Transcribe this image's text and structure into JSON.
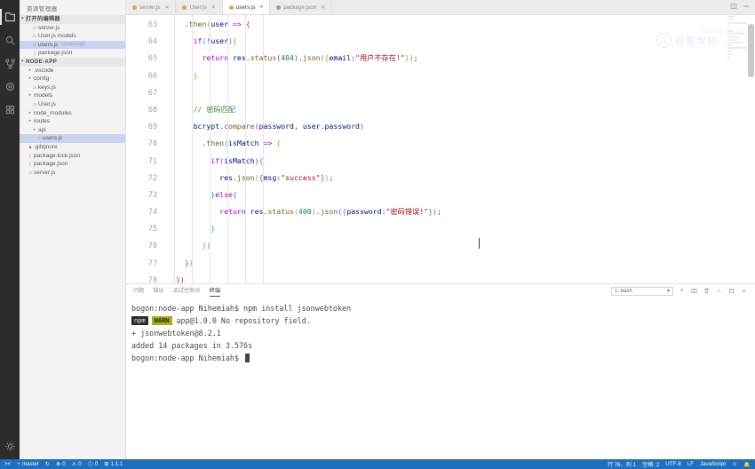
{
  "activity_bar": {
    "items": [
      {
        "name": "explorer",
        "icon": "files-icon",
        "active": true
      },
      {
        "name": "search",
        "icon": "search-icon",
        "active": false
      },
      {
        "name": "source-control",
        "icon": "source-control-icon",
        "active": false
      },
      {
        "name": "debug",
        "icon": "debug-icon",
        "active": false
      },
      {
        "name": "extensions",
        "icon": "extensions-icon",
        "active": false
      }
    ],
    "bottom": [
      {
        "name": "manage",
        "icon": "gear-icon"
      }
    ]
  },
  "sidebar": {
    "title": "资源管理器",
    "sections": [
      {
        "label": "打开的编辑器",
        "expanded": true,
        "items": [
          {
            "label": "server.js",
            "icon": "js-file-icon",
            "indent": 2,
            "selected": false,
            "meta": ""
          },
          {
            "label": "User.js  models",
            "icon": "js-file-icon",
            "indent": 2,
            "selected": false,
            "meta": ""
          },
          {
            "label": "users.js",
            "icon": "js-file-icon",
            "indent": 2,
            "selected": true,
            "meta": "routes/api"
          },
          {
            "label": "package.json",
            "icon": "json-file-icon",
            "indent": 2,
            "selected": false,
            "meta": ""
          }
        ]
      },
      {
        "label": "NODE-APP",
        "expanded": true,
        "items": [
          {
            "label": ".vscode",
            "icon": "folder-icon",
            "indent": 1,
            "selected": false,
            "meta": ""
          },
          {
            "label": "config",
            "icon": "folder-icon",
            "indent": 1,
            "selected": false,
            "meta": ""
          },
          {
            "label": "keys.js",
            "icon": "js-file-icon",
            "indent": 2,
            "selected": false,
            "meta": ""
          },
          {
            "label": "models",
            "icon": "folder-icon",
            "indent": 1,
            "selected": false,
            "meta": ""
          },
          {
            "label": "User.js",
            "icon": "js-file-icon",
            "indent": 2,
            "selected": false,
            "meta": ""
          },
          {
            "label": "node_modules",
            "icon": "folder-icon",
            "indent": 1,
            "selected": false,
            "meta": ""
          },
          {
            "label": "routes",
            "icon": "folder-icon",
            "indent": 1,
            "selected": false,
            "meta": ""
          },
          {
            "label": "api",
            "icon": "folder-icon",
            "indent": 2,
            "selected": false,
            "meta": ""
          },
          {
            "label": "users.js",
            "icon": "js-file-icon",
            "indent": 3,
            "selected": true,
            "meta": ""
          },
          {
            "label": ".gitignore",
            "icon": "git-file-icon",
            "indent": 1,
            "selected": false,
            "meta": ""
          },
          {
            "label": "package-lock.json",
            "icon": "json-file-icon",
            "indent": 1,
            "selected": false,
            "meta": ""
          },
          {
            "label": "package.json",
            "icon": "json-file-icon",
            "indent": 1,
            "selected": false,
            "meta": ""
          },
          {
            "label": "server.js",
            "icon": "js-file-icon",
            "indent": 1,
            "selected": false,
            "meta": ""
          }
        ]
      }
    ]
  },
  "tabs": [
    {
      "label": "server.js",
      "color": "#cbb243",
      "active": false,
      "dirty": false
    },
    {
      "label": "User.js",
      "color": "#cbb243",
      "active": false,
      "dirty": false
    },
    {
      "label": "users.js",
      "color": "#cbb243",
      "active": true,
      "dirty": true
    },
    {
      "label": "package.json",
      "color": "#9a9a9a",
      "active": false,
      "dirty": false
    }
  ],
  "tabbar_actions": [
    {
      "name": "split-editor-icon"
    },
    {
      "name": "more-actions-icon"
    }
  ],
  "editor": {
    "first_line": 63,
    "lines": [
      {
        "n": 63,
        "segments": [
          {
            "t": "    .",
            "c": "op"
          },
          {
            "t": "then",
            "c": "fn"
          },
          {
            "t": "(",
            "c": "br1"
          },
          {
            "t": "user",
            "c": "var"
          },
          {
            "t": " => ",
            "c": "kw"
          },
          {
            "t": "{",
            "c": "br2"
          }
        ]
      },
      {
        "n": 64,
        "segments": [
          {
            "t": "      ",
            "c": "op"
          },
          {
            "t": "if",
            "c": "kw"
          },
          {
            "t": "(",
            "c": "br3"
          },
          {
            "t": "!",
            "c": "op"
          },
          {
            "t": "user",
            "c": "var"
          },
          {
            "t": ")",
            "c": "br3"
          },
          {
            "t": "{",
            "c": "br1"
          }
        ]
      },
      {
        "n": 65,
        "segments": [
          {
            "t": "        ",
            "c": "op"
          },
          {
            "t": "return",
            "c": "kw"
          },
          {
            "t": " ",
            "c": "op"
          },
          {
            "t": "res",
            "c": "var"
          },
          {
            "t": ".",
            "c": "op"
          },
          {
            "t": "status",
            "c": "fn"
          },
          {
            "t": "(",
            "c": "br2"
          },
          {
            "t": "404",
            "c": "num"
          },
          {
            "t": ")",
            "c": "br2"
          },
          {
            "t": ".",
            "c": "op"
          },
          {
            "t": "json",
            "c": "fn"
          },
          {
            "t": "(",
            "c": "br3"
          },
          {
            "t": "{",
            "c": "br1"
          },
          {
            "t": "email",
            "c": "var"
          },
          {
            "t": ":",
            "c": "op"
          },
          {
            "t": "\"用户不存在!\"",
            "c": "str"
          },
          {
            "t": "}",
            "c": "br1"
          },
          {
            "t": ")",
            "c": "br3"
          },
          {
            "t": ";",
            "c": "op"
          }
        ]
      },
      {
        "n": 66,
        "segments": [
          {
            "t": "      ",
            "c": "op"
          },
          {
            "t": "}",
            "c": "br1"
          }
        ]
      },
      {
        "n": 67,
        "segments": []
      },
      {
        "n": 68,
        "segments": [
          {
            "t": "      ",
            "c": "op"
          },
          {
            "t": "// 密码匹配",
            "c": "com"
          }
        ]
      },
      {
        "n": 69,
        "segments": [
          {
            "t": "      ",
            "c": "op"
          },
          {
            "t": "bcrypt",
            "c": "var"
          },
          {
            "t": ".",
            "c": "op"
          },
          {
            "t": "compare",
            "c": "fn"
          },
          {
            "t": "(",
            "c": "br2"
          },
          {
            "t": "password",
            "c": "var"
          },
          {
            "t": ", ",
            "c": "op"
          },
          {
            "t": "user",
            "c": "var"
          },
          {
            "t": ".",
            "c": "op"
          },
          {
            "t": "password",
            "c": "var"
          },
          {
            "t": ")",
            "c": "br2"
          }
        ]
      },
      {
        "n": 70,
        "segments": [
          {
            "t": "        .",
            "c": "op"
          },
          {
            "t": "then",
            "c": "fn"
          },
          {
            "t": "(",
            "c": "br3"
          },
          {
            "t": "isMatch",
            "c": "var"
          },
          {
            "t": " => ",
            "c": "kw"
          },
          {
            "t": "{",
            "c": "br1"
          }
        ]
      },
      {
        "n": 71,
        "segments": [
          {
            "t": "          ",
            "c": "op"
          },
          {
            "t": "if",
            "c": "kw"
          },
          {
            "t": "(",
            "c": "br2"
          },
          {
            "t": "isMatch",
            "c": "var"
          },
          {
            "t": ")",
            "c": "br2"
          },
          {
            "t": "{",
            "c": "br3"
          }
        ]
      },
      {
        "n": 72,
        "segments": [
          {
            "t": "            ",
            "c": "op"
          },
          {
            "t": "res",
            "c": "var"
          },
          {
            "t": ".",
            "c": "op"
          },
          {
            "t": "json",
            "c": "fn"
          },
          {
            "t": "(",
            "c": "br1"
          },
          {
            "t": "{",
            "c": "br2"
          },
          {
            "t": "msg",
            "c": "var"
          },
          {
            "t": ":",
            "c": "op"
          },
          {
            "t": "\"success\"",
            "c": "str"
          },
          {
            "t": "}",
            "c": "br2"
          },
          {
            "t": ")",
            "c": "br1"
          },
          {
            "t": ";",
            "c": "op"
          }
        ]
      },
      {
        "n": 73,
        "segments": [
          {
            "t": "          ",
            "c": "op"
          },
          {
            "t": "}",
            "c": "br3"
          },
          {
            "t": "else",
            "c": "kw"
          },
          {
            "t": "{",
            "c": "br3"
          }
        ]
      },
      {
        "n": 74,
        "segments": [
          {
            "t": "            ",
            "c": "op"
          },
          {
            "t": "return",
            "c": "kw"
          },
          {
            "t": " ",
            "c": "op"
          },
          {
            "t": "res",
            "c": "var"
          },
          {
            "t": ".",
            "c": "op"
          },
          {
            "t": "status",
            "c": "fn"
          },
          {
            "t": "(",
            "c": "br1"
          },
          {
            "t": "400",
            "c": "num"
          },
          {
            "t": ")",
            "c": "br1"
          },
          {
            "t": ".",
            "c": "op"
          },
          {
            "t": "json",
            "c": "fn"
          },
          {
            "t": "(",
            "c": "br2"
          },
          {
            "t": "{",
            "c": "br3"
          },
          {
            "t": "password",
            "c": "var"
          },
          {
            "t": ":",
            "c": "op"
          },
          {
            "t": "\"密码错误!\"",
            "c": "str"
          },
          {
            "t": "}",
            "c": "br3"
          },
          {
            "t": ")",
            "c": "br2"
          },
          {
            "t": ";",
            "c": "op"
          }
        ]
      },
      {
        "n": 75,
        "segments": [
          {
            "t": "          ",
            "c": "op"
          },
          {
            "t": "}",
            "c": "br3"
          }
        ]
      },
      {
        "n": 76,
        "segments": [
          {
            "t": "        ",
            "c": "op"
          },
          {
            "t": "}",
            "c": "br1"
          },
          {
            "t": ")",
            "c": "br3"
          }
        ]
      },
      {
        "n": 77,
        "segments": [
          {
            "t": "    ",
            "c": "op"
          },
          {
            "t": "}",
            "c": "br2"
          },
          {
            "t": ")",
            "c": "br1"
          }
        ]
      },
      {
        "n": 78,
        "segments": [
          {
            "t": "  ",
            "c": "op"
          },
          {
            "t": "}",
            "c": "br2"
          },
          {
            "t": ")",
            "c": "br2"
          }
        ]
      }
    ],
    "cursor_line": 76,
    "watermark": {
      "text": "极客学院",
      "logo": "G"
    },
    "watermark_sub": "jikexueyuan.com"
  },
  "panel": {
    "tabs": [
      {
        "label": "问题",
        "active": false
      },
      {
        "label": "输出",
        "active": false
      },
      {
        "label": "调试控制台",
        "active": false
      },
      {
        "label": "终端",
        "active": true
      }
    ],
    "terminal_select": "1: bash",
    "actions": [
      {
        "name": "new-terminal-icon",
        "glyph": "+"
      },
      {
        "name": "split-terminal-icon",
        "glyph": "▤"
      },
      {
        "name": "kill-terminal-icon",
        "glyph": "🗑"
      },
      {
        "name": "chevron-up-icon",
        "glyph": "︿"
      },
      {
        "name": "maximize-panel-icon",
        "glyph": "▢"
      },
      {
        "name": "close-panel-icon",
        "glyph": "✕"
      }
    ],
    "terminal_lines": [
      {
        "type": "plain",
        "text": "bogon:node-app Nihemiah$ npm install jsonwebtoken"
      },
      {
        "type": "warn",
        "badge1": "npm",
        "badge2": "WARN",
        "text": "app@1.0.0 No repository field."
      },
      {
        "type": "blank",
        "text": ""
      },
      {
        "type": "plain",
        "text": "+ jsonwebtoken@8.2.1"
      },
      {
        "type": "plain",
        "text": "added 14 packages in 3.576s"
      },
      {
        "type": "prompt",
        "text": "bogon:node-app Nihemiah$ "
      }
    ]
  },
  "statusbar": {
    "left": [
      {
        "name": "remote-icon",
        "label": "",
        "icon": "remote"
      },
      {
        "name": "branch",
        "label": "master",
        "icon": "branch"
      },
      {
        "name": "sync",
        "label": "",
        "icon": "sync"
      },
      {
        "name": "errors",
        "label": "0",
        "icon": "error"
      },
      {
        "name": "warnings",
        "label": "0",
        "icon": "warning"
      },
      {
        "name": "info",
        "label": "0",
        "icon": "info"
      },
      {
        "name": "ports",
        "label": "1.1.1",
        "icon": "ports"
      }
    ],
    "right": [
      {
        "name": "cursor-position",
        "label": "行 76，列 1"
      },
      {
        "name": "indentation",
        "label": "空格: 2"
      },
      {
        "name": "encoding",
        "label": "UTF-8"
      },
      {
        "name": "eol",
        "label": "LF"
      },
      {
        "name": "language-mode",
        "label": "JavaScript"
      },
      {
        "name": "feedback",
        "label": ""
      },
      {
        "name": "notifications",
        "label": ""
      }
    ]
  },
  "colors": {
    "accent": "#1e6fbd",
    "selection": "#cdd3ef",
    "warn_badge": "#a3b018"
  }
}
